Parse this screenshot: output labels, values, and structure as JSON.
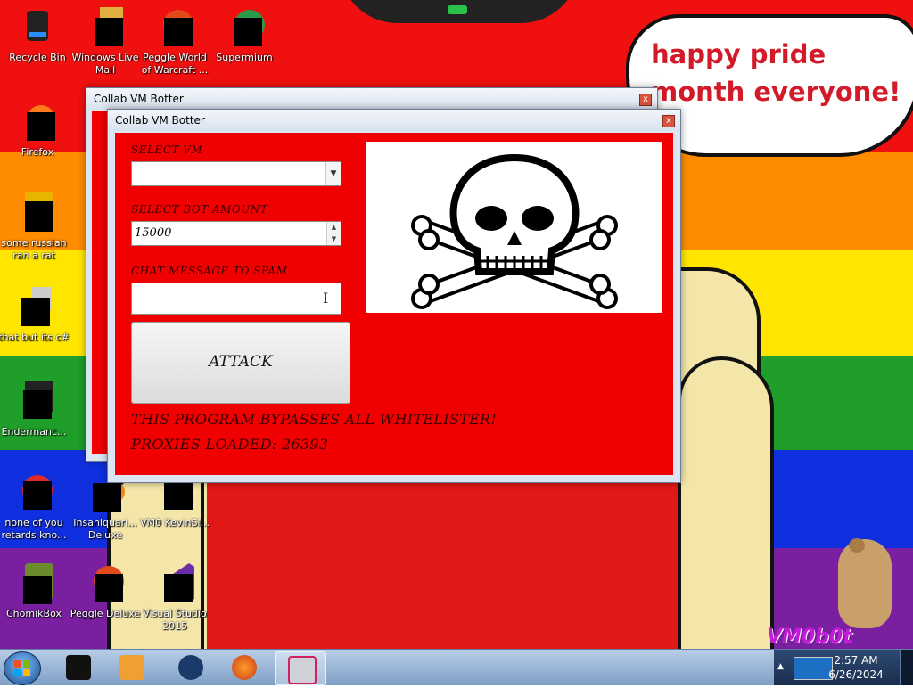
{
  "wallpaper": {
    "bubble_text": "happy pride month everyone!",
    "watermark": "VM0b0t"
  },
  "desktop_icons": [
    {
      "label": "Recycle Bin",
      "icon": "recycle-bin-icon"
    },
    {
      "label": "Windows Live Mail",
      "icon": "windows-live-mail-icon"
    },
    {
      "label": "Peggle World of Warcraft ...",
      "icon": "peggle-icon"
    },
    {
      "label": "Supermium",
      "icon": "supermium-icon"
    },
    {
      "label": "Firefox",
      "icon": "firefox-icon"
    },
    {
      "label": "some russian ran a rat",
      "icon": "shortcut-icon"
    },
    {
      "label": "that but its c#",
      "icon": "shortcut-icon"
    },
    {
      "label": "Endermanc...",
      "icon": "shortcut-icon"
    },
    {
      "label": "none of you retards kno...",
      "icon": "opera-icon"
    },
    {
      "label": "Insaniquari... Deluxe",
      "icon": "insaniquarium-icon"
    },
    {
      "label": "VM0 KevinSi...",
      "icon": "shortcut-icon"
    },
    {
      "label": "ChomikBox",
      "icon": "chomikbox-icon"
    },
    {
      "label": "Peggle Deluxe",
      "icon": "peggle-icon"
    },
    {
      "label": "Visual Studio 2015",
      "icon": "visual-studio-icon"
    }
  ],
  "back_window": {
    "title": "Collab VM Botter",
    "close": "x"
  },
  "front_window": {
    "title": "Collab VM Botter",
    "close": "x",
    "select_vm_label": "SELECT VM",
    "select_vm_value": "",
    "bot_amount_label": "SELECT BOT AMOUNT",
    "bot_amount_value": "15000",
    "spin_up": "▲",
    "spin_down": "▼",
    "combo_arrow": "▼",
    "chat_label": "CHAT MESSAGE TO SPAM",
    "chat_value": "",
    "attack_label": "ATTACK",
    "bypass_text": "THIS PROGRAM BYPASSES ALL WHITELISTER!",
    "proxies_text": "PROXIES LOADED: 26393",
    "image_icon": "skull-and-crossbones-icon"
  },
  "taskbar": {
    "items": [
      {
        "icon": "black-box-icon"
      },
      {
        "icon": "media-player-icon"
      },
      {
        "icon": "globe-icon"
      },
      {
        "icon": "firefox-icon"
      },
      {
        "icon": "collab-vm-botter-icon",
        "active": true
      }
    ],
    "tray_icon": "tray-app-icon",
    "time": "2:57 AM",
    "date": "6/26/2024"
  },
  "colors": {
    "form_background": "#f00000",
    "bubble_text": "#d21a28",
    "watermark": "#c21ad8"
  }
}
